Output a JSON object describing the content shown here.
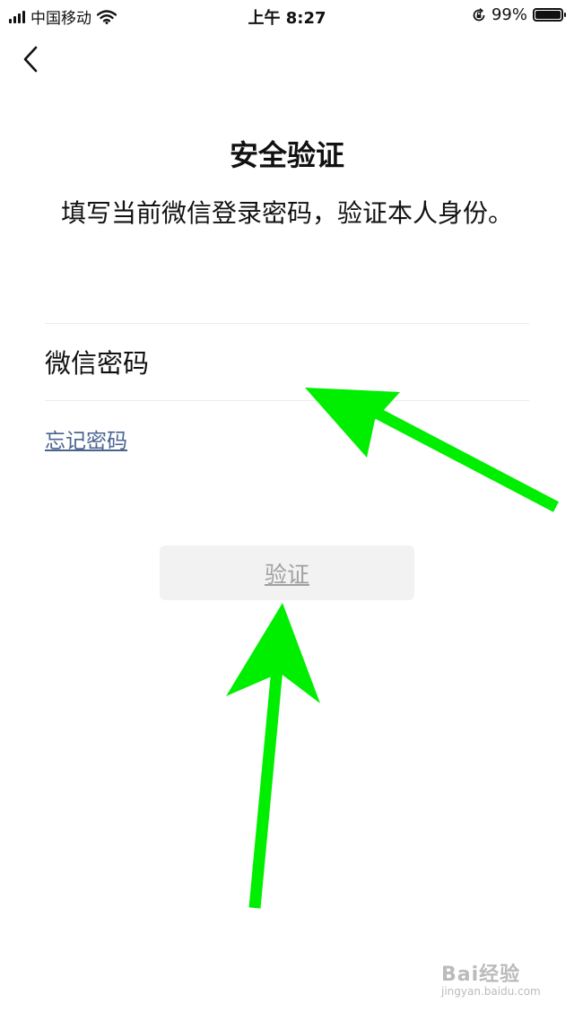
{
  "status_bar": {
    "carrier": "中国移动",
    "time": "上午 8:27",
    "battery": "99%",
    "battery_level": 0.99
  },
  "page": {
    "title": "安全验证",
    "subtitle": "填写当前微信登录密码，验证本人身份。",
    "password_placeholder": "微信密码",
    "forgot_label": "忘记密码",
    "verify_label": "验证"
  },
  "icons": {
    "back": "chevron-left-icon",
    "signal": "signal-bars-icon",
    "wifi": "wifi-icon",
    "orientation_lock": "orientation-lock-icon",
    "battery": "battery-icon"
  },
  "colors": {
    "link": "#4a6491",
    "button_bg": "#f2f2f2",
    "button_text": "#a0a0a0",
    "arrow": "#00ee00",
    "divider": "#ececec"
  },
  "watermark": {
    "text": "Bai经验",
    "url": "jingyan.baidu.com"
  }
}
